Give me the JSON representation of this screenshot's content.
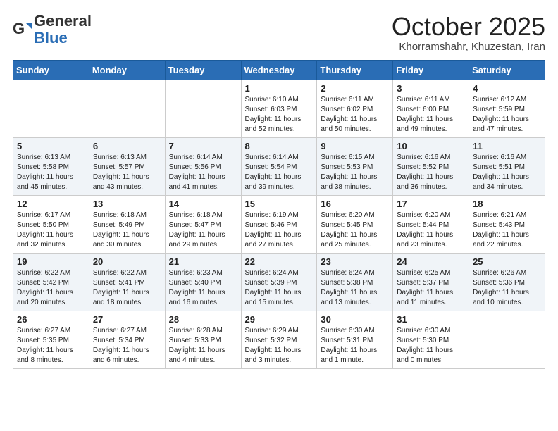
{
  "header": {
    "logo_general": "General",
    "logo_blue": "Blue",
    "month": "October 2025",
    "location": "Khorramshahr, Khuzestan, Iran"
  },
  "weekdays": [
    "Sunday",
    "Monday",
    "Tuesday",
    "Wednesday",
    "Thursday",
    "Friday",
    "Saturday"
  ],
  "weeks": [
    [
      {
        "day": "",
        "info": ""
      },
      {
        "day": "",
        "info": ""
      },
      {
        "day": "",
        "info": ""
      },
      {
        "day": "1",
        "info": "Sunrise: 6:10 AM\nSunset: 6:03 PM\nDaylight: 11 hours\nand 52 minutes."
      },
      {
        "day": "2",
        "info": "Sunrise: 6:11 AM\nSunset: 6:02 PM\nDaylight: 11 hours\nand 50 minutes."
      },
      {
        "day": "3",
        "info": "Sunrise: 6:11 AM\nSunset: 6:00 PM\nDaylight: 11 hours\nand 49 minutes."
      },
      {
        "day": "4",
        "info": "Sunrise: 6:12 AM\nSunset: 5:59 PM\nDaylight: 11 hours\nand 47 minutes."
      }
    ],
    [
      {
        "day": "5",
        "info": "Sunrise: 6:13 AM\nSunset: 5:58 PM\nDaylight: 11 hours\nand 45 minutes."
      },
      {
        "day": "6",
        "info": "Sunrise: 6:13 AM\nSunset: 5:57 PM\nDaylight: 11 hours\nand 43 minutes."
      },
      {
        "day": "7",
        "info": "Sunrise: 6:14 AM\nSunset: 5:56 PM\nDaylight: 11 hours\nand 41 minutes."
      },
      {
        "day": "8",
        "info": "Sunrise: 6:14 AM\nSunset: 5:54 PM\nDaylight: 11 hours\nand 39 minutes."
      },
      {
        "day": "9",
        "info": "Sunrise: 6:15 AM\nSunset: 5:53 PM\nDaylight: 11 hours\nand 38 minutes."
      },
      {
        "day": "10",
        "info": "Sunrise: 6:16 AM\nSunset: 5:52 PM\nDaylight: 11 hours\nand 36 minutes."
      },
      {
        "day": "11",
        "info": "Sunrise: 6:16 AM\nSunset: 5:51 PM\nDaylight: 11 hours\nand 34 minutes."
      }
    ],
    [
      {
        "day": "12",
        "info": "Sunrise: 6:17 AM\nSunset: 5:50 PM\nDaylight: 11 hours\nand 32 minutes."
      },
      {
        "day": "13",
        "info": "Sunrise: 6:18 AM\nSunset: 5:49 PM\nDaylight: 11 hours\nand 30 minutes."
      },
      {
        "day": "14",
        "info": "Sunrise: 6:18 AM\nSunset: 5:47 PM\nDaylight: 11 hours\nand 29 minutes."
      },
      {
        "day": "15",
        "info": "Sunrise: 6:19 AM\nSunset: 5:46 PM\nDaylight: 11 hours\nand 27 minutes."
      },
      {
        "day": "16",
        "info": "Sunrise: 6:20 AM\nSunset: 5:45 PM\nDaylight: 11 hours\nand 25 minutes."
      },
      {
        "day": "17",
        "info": "Sunrise: 6:20 AM\nSunset: 5:44 PM\nDaylight: 11 hours\nand 23 minutes."
      },
      {
        "day": "18",
        "info": "Sunrise: 6:21 AM\nSunset: 5:43 PM\nDaylight: 11 hours\nand 22 minutes."
      }
    ],
    [
      {
        "day": "19",
        "info": "Sunrise: 6:22 AM\nSunset: 5:42 PM\nDaylight: 11 hours\nand 20 minutes."
      },
      {
        "day": "20",
        "info": "Sunrise: 6:22 AM\nSunset: 5:41 PM\nDaylight: 11 hours\nand 18 minutes."
      },
      {
        "day": "21",
        "info": "Sunrise: 6:23 AM\nSunset: 5:40 PM\nDaylight: 11 hours\nand 16 minutes."
      },
      {
        "day": "22",
        "info": "Sunrise: 6:24 AM\nSunset: 5:39 PM\nDaylight: 11 hours\nand 15 minutes."
      },
      {
        "day": "23",
        "info": "Sunrise: 6:24 AM\nSunset: 5:38 PM\nDaylight: 11 hours\nand 13 minutes."
      },
      {
        "day": "24",
        "info": "Sunrise: 6:25 AM\nSunset: 5:37 PM\nDaylight: 11 hours\nand 11 minutes."
      },
      {
        "day": "25",
        "info": "Sunrise: 6:26 AM\nSunset: 5:36 PM\nDaylight: 11 hours\nand 10 minutes."
      }
    ],
    [
      {
        "day": "26",
        "info": "Sunrise: 6:27 AM\nSunset: 5:35 PM\nDaylight: 11 hours\nand 8 minutes."
      },
      {
        "day": "27",
        "info": "Sunrise: 6:27 AM\nSunset: 5:34 PM\nDaylight: 11 hours\nand 6 minutes."
      },
      {
        "day": "28",
        "info": "Sunrise: 6:28 AM\nSunset: 5:33 PM\nDaylight: 11 hours\nand 4 minutes."
      },
      {
        "day": "29",
        "info": "Sunrise: 6:29 AM\nSunset: 5:32 PM\nDaylight: 11 hours\nand 3 minutes."
      },
      {
        "day": "30",
        "info": "Sunrise: 6:30 AM\nSunset: 5:31 PM\nDaylight: 11 hours\nand 1 minute."
      },
      {
        "day": "31",
        "info": "Sunrise: 6:30 AM\nSunset: 5:30 PM\nDaylight: 11 hours\nand 0 minutes."
      },
      {
        "day": "",
        "info": ""
      }
    ]
  ]
}
